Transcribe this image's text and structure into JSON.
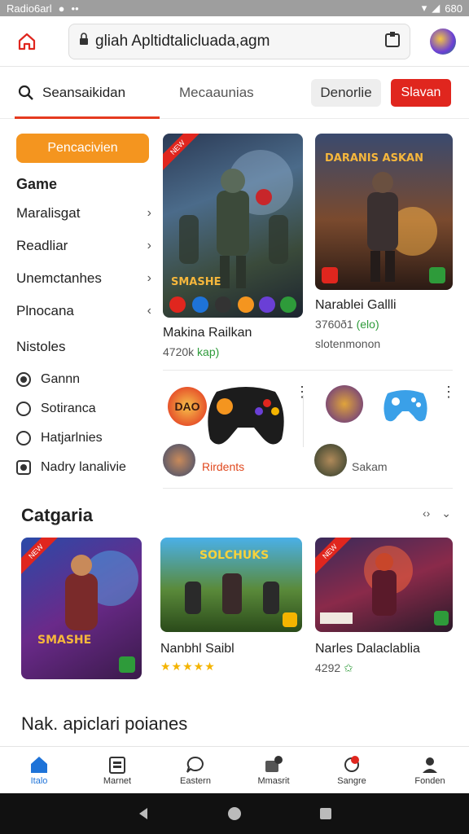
{
  "status": {
    "left_text": "Radio6arl",
    "right_text": "680"
  },
  "browser": {
    "url": "gliah Apltidtalicluada,agm"
  },
  "tabs": {
    "search_label": "Seansaikidan",
    "second_label": "Mecaaunias",
    "ghost_button": "Denorlie",
    "red_button": "Slavan"
  },
  "sidebar": {
    "primary_button": "Pencacivien",
    "heading": "Game",
    "items": [
      {
        "label": "Maralisgat",
        "chev": "›"
      },
      {
        "label": "Readliar",
        "chev": "›"
      },
      {
        "label": "Unemctanhes",
        "chev": "›"
      },
      {
        "label": "Plnocana",
        "chev": "‹"
      }
    ],
    "heading2": "Nistoles",
    "radios": [
      {
        "label": "Gannn",
        "checked": true
      },
      {
        "label": "Sotiranca",
        "checked": false
      },
      {
        "label": "Hatjarlnies",
        "checked": false
      },
      {
        "label": "Nadry lanalivie",
        "checked": false
      }
    ]
  },
  "featured": [
    {
      "title": "Makina Railkan",
      "sub_main": "4720k",
      "sub_green": "kap)",
      "ribbon": "NEW",
      "art_text": "SMASHE"
    },
    {
      "title": "Narablei Gallli",
      "sub_main": "3760ð1",
      "sub_green": "(elo)",
      "ribbon": "",
      "art_text": "DARANIS ASKAN"
    }
  ],
  "featured_third": {
    "sub": "slotenmonon"
  },
  "mini_apps": [
    {
      "badge": "DAO",
      "label": "Rirdents"
    },
    {
      "badge": "",
      "label": "Sakam"
    }
  ],
  "category": {
    "title": "Catgaria",
    "ctrl_prev": "‹›",
    "ctrl_next": "⌄",
    "cards": [
      {
        "title": "",
        "ribbon": "NEW",
        "art_text": "SMASHE"
      },
      {
        "title": "Nanbhl Saibl",
        "stars": "★★★★★",
        "art_text": "SOLCHUKS"
      },
      {
        "title": "Narles Dalaclablia",
        "rating": "4292",
        "ribbon": "NEW",
        "art_text": ""
      }
    ]
  },
  "bottom_section_title": "Nak. apiclari poianes",
  "bottom_nav": [
    {
      "label": "Italo",
      "icon": "home-icon"
    },
    {
      "label": "Marnet",
      "icon": "calendar-icon"
    },
    {
      "label": "Eastern",
      "icon": "chat-icon"
    },
    {
      "label": "Mmasrit",
      "icon": "message-icon"
    },
    {
      "label": "Sangre",
      "icon": "location-icon"
    },
    {
      "label": "Fonden",
      "icon": "profile-icon"
    }
  ],
  "colors": {
    "accent": "#e53a1f",
    "primary_orange": "#f4951f",
    "active_nav": "#1e73d8"
  }
}
